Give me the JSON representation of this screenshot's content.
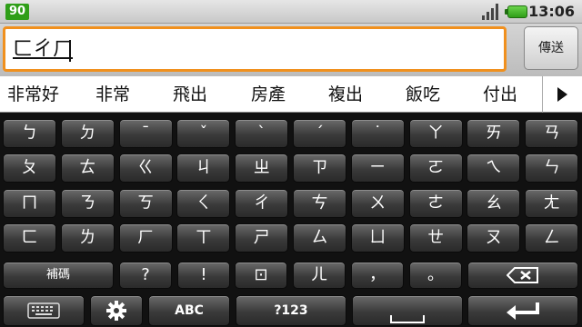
{
  "status_bar": {
    "battery_level": "90",
    "time": "13:06",
    "icons": [
      "signal-icon",
      "battery-icon"
    ]
  },
  "input": {
    "composing_text": "ㄈㄔㄏ",
    "send_label": "傳送"
  },
  "candidates": [
    "非常好",
    "非常",
    "飛出",
    "房產",
    "複出",
    "飯吃",
    "付出"
  ],
  "keyboard": {
    "rows": [
      [
        "ㄅ",
        "ㄉ",
        "ˉ",
        "ˇ",
        "ˋ",
        "ˊ",
        "˙",
        "ㄚ",
        "ㄞ",
        "ㄢ"
      ],
      [
        "ㄆ",
        "ㄊ",
        "ㄍ",
        "ㄐ",
        "ㄓ",
        "ㄗ",
        "ㄧ",
        "ㄛ",
        "ㄟ",
        "ㄣ"
      ],
      [
        "ㄇ",
        "ㄋ",
        "ㄎ",
        "ㄑ",
        "ㄔ",
        "ㄘ",
        "ㄨ",
        "ㄜ",
        "ㄠ",
        "ㄤ"
      ],
      [
        "ㄈ",
        "ㄌ",
        "ㄏ",
        "ㄒ",
        "ㄕ",
        "ㄙ",
        "ㄩ",
        "ㄝ",
        "ㄡ",
        "ㄥ"
      ]
    ],
    "row5": {
      "supplement_label": "補碼",
      "symbols": [
        "?",
        "!",
        "⊡",
        "ㄦ",
        "，",
        "。"
      ]
    },
    "row6": {
      "abc_label": "ABC",
      "num_label": "?123"
    },
    "icons": [
      "keyboard-icon",
      "gear-icon",
      "backspace-icon",
      "enter-icon"
    ]
  }
}
